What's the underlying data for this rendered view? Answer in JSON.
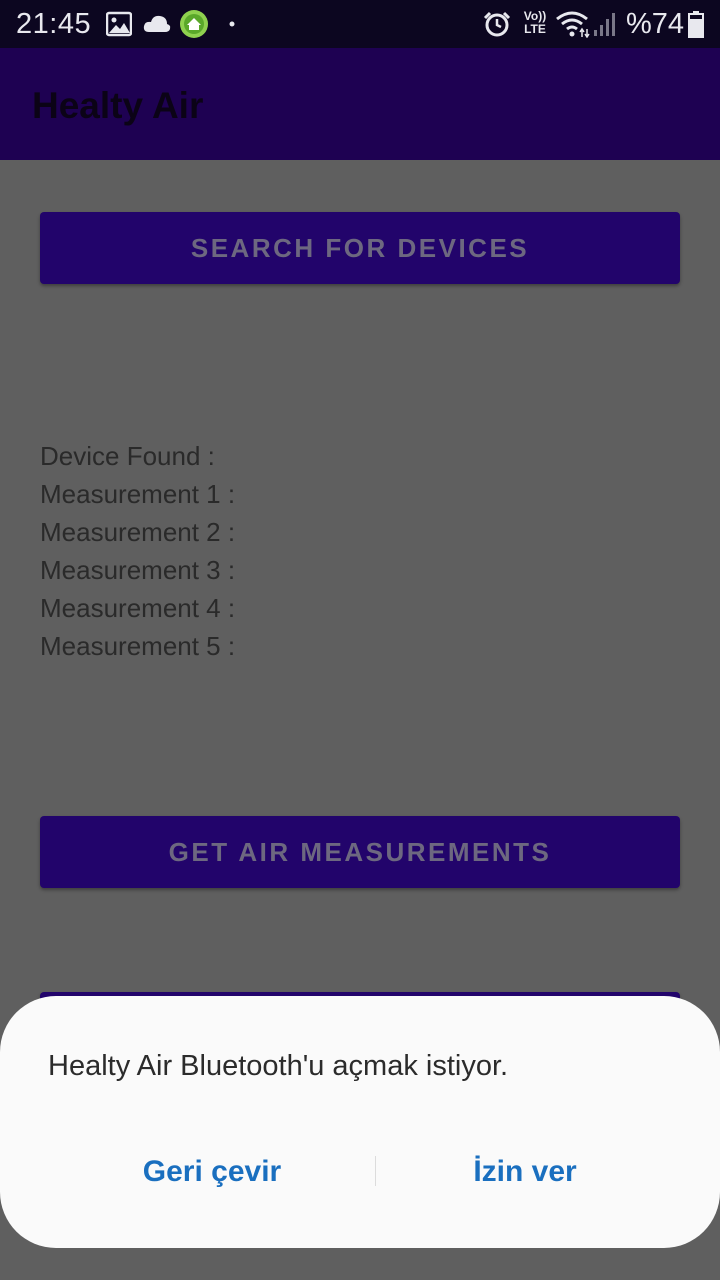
{
  "status_bar": {
    "time": "21:45",
    "battery_text": "%74",
    "left_icons": [
      "gallery-icon",
      "cloud-icon",
      "app-notification-icon",
      "dot-icon"
    ],
    "right_icons": [
      "alarm-icon",
      "volte-icon",
      "wifi-icon",
      "signal-icon",
      "battery-icon"
    ],
    "volte_top": "Vo))",
    "volte_bottom": "LTE"
  },
  "app_bar": {
    "title": "Healty Air",
    "color": "#1e0152"
  },
  "main": {
    "search_button_label": "SEARCH FOR DEVICES",
    "info": {
      "device_found": "Device Found :",
      "measurement_1": "Measurement 1 :",
      "measurement_2": "Measurement 2 :",
      "measurement_3": "Measurement 3 :",
      "measurement_4": "Measurement 4 :",
      "measurement_5": "Measurement 5 :"
    },
    "air_button_label": "GET AIR MEASUREMENTS"
  },
  "dialog": {
    "message": "Healty Air Bluetooth'u açmak istiyor.",
    "deny_label": "Geri çevir",
    "allow_label": "İzin ver",
    "accent_color": "#1a6fbf"
  }
}
